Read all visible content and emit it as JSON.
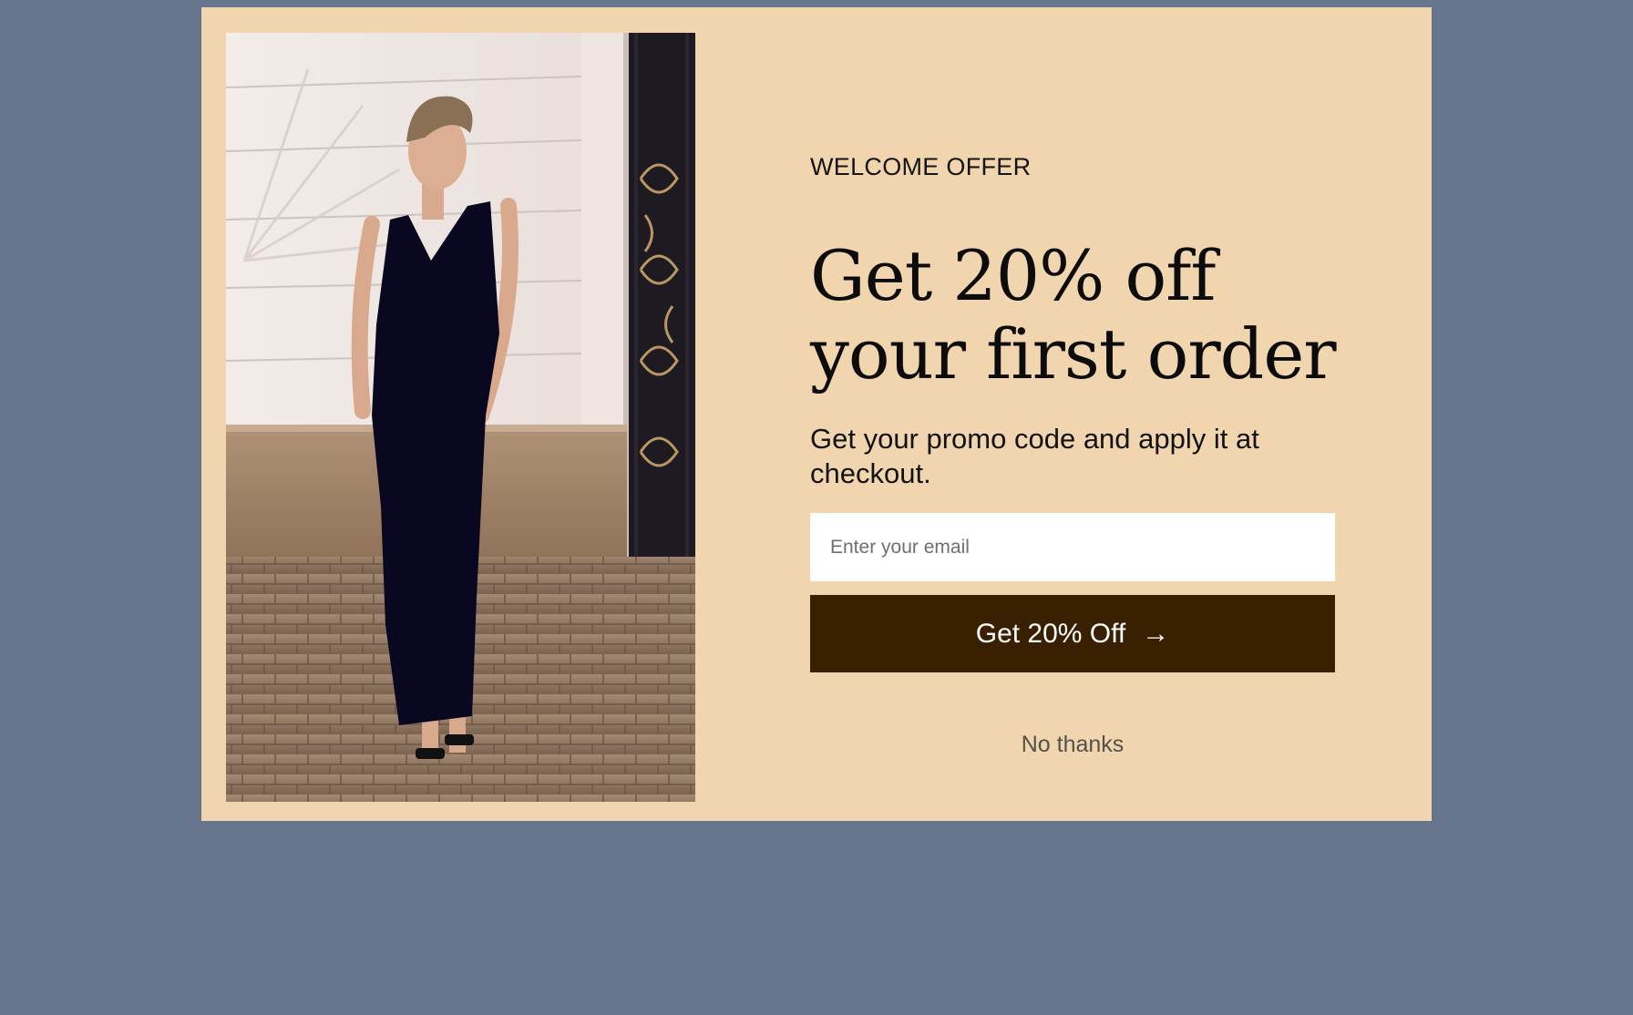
{
  "popup": {
    "eyebrow": "WELCOME OFFER",
    "headline_line1": "Get 20% off",
    "headline_line2": "your first order",
    "subtext": "Get your promo code and apply it at checkout.",
    "email_placeholder": "Enter your email",
    "email_value": "",
    "cta_label": "Get 20% Off",
    "cta_icon": "arrow-right-icon",
    "dismiss_label": "No thanks",
    "image": "woman-in-black-dress-photo"
  },
  "colors": {
    "page_overlay": "#66758c",
    "modal_background": "#f0d5ae",
    "cta_background": "#392000",
    "cta_text": "#ffffff"
  }
}
